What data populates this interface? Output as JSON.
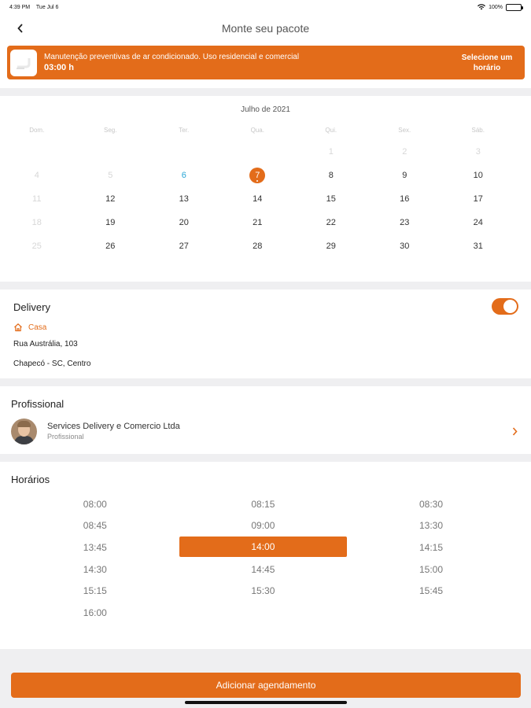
{
  "status_bar": {
    "time": "4:39 PM",
    "date": "Tue Jul 6",
    "battery": "100%"
  },
  "nav": {
    "title": "Monte seu pacote"
  },
  "service": {
    "name": "Manutenção preventivas de ar condicionado.  Uso residencial e comercial",
    "duration": "03:00 h",
    "select_time_label": "Selecione um horário"
  },
  "calendar": {
    "month_label": "Julho de 2021",
    "weekdays": [
      "Dom.",
      "Seg.",
      "Ter.",
      "Qua.",
      "Qui.",
      "Sex.",
      "Sáb."
    ],
    "weeks": [
      [
        "",
        "",
        "",
        "",
        "1",
        "2",
        "3"
      ],
      [
        "4",
        "5",
        "6",
        "7",
        "8",
        "9",
        "10"
      ],
      [
        "11",
        "12",
        "13",
        "14",
        "15",
        "16",
        "17"
      ],
      [
        "18",
        "19",
        "20",
        "21",
        "22",
        "23",
        "24"
      ],
      [
        "25",
        "26",
        "27",
        "28",
        "29",
        "30",
        "31"
      ]
    ]
  },
  "delivery": {
    "title": "Delivery",
    "address_label": "Casa",
    "street": "Rua Austrália, 103",
    "city": "Chapecó - SC, Centro"
  },
  "professional": {
    "title": "Profissional",
    "name": "Services Delivery e Comercio Ltda",
    "role": "Profissional"
  },
  "times": {
    "title": "Horários",
    "slots": [
      "08:00",
      "08:15",
      "08:30",
      "08:45",
      "09:00",
      "13:30",
      "13:45",
      "14:00",
      "14:15",
      "14:30",
      "14:45",
      "15:00",
      "15:15",
      "15:30",
      "15:45",
      "16:00"
    ],
    "selected": "14:00"
  },
  "footer": {
    "add_button_label": "Adicionar agendamento"
  },
  "colors": {
    "accent": "#e36c1a",
    "today": "#2aa7d6"
  }
}
